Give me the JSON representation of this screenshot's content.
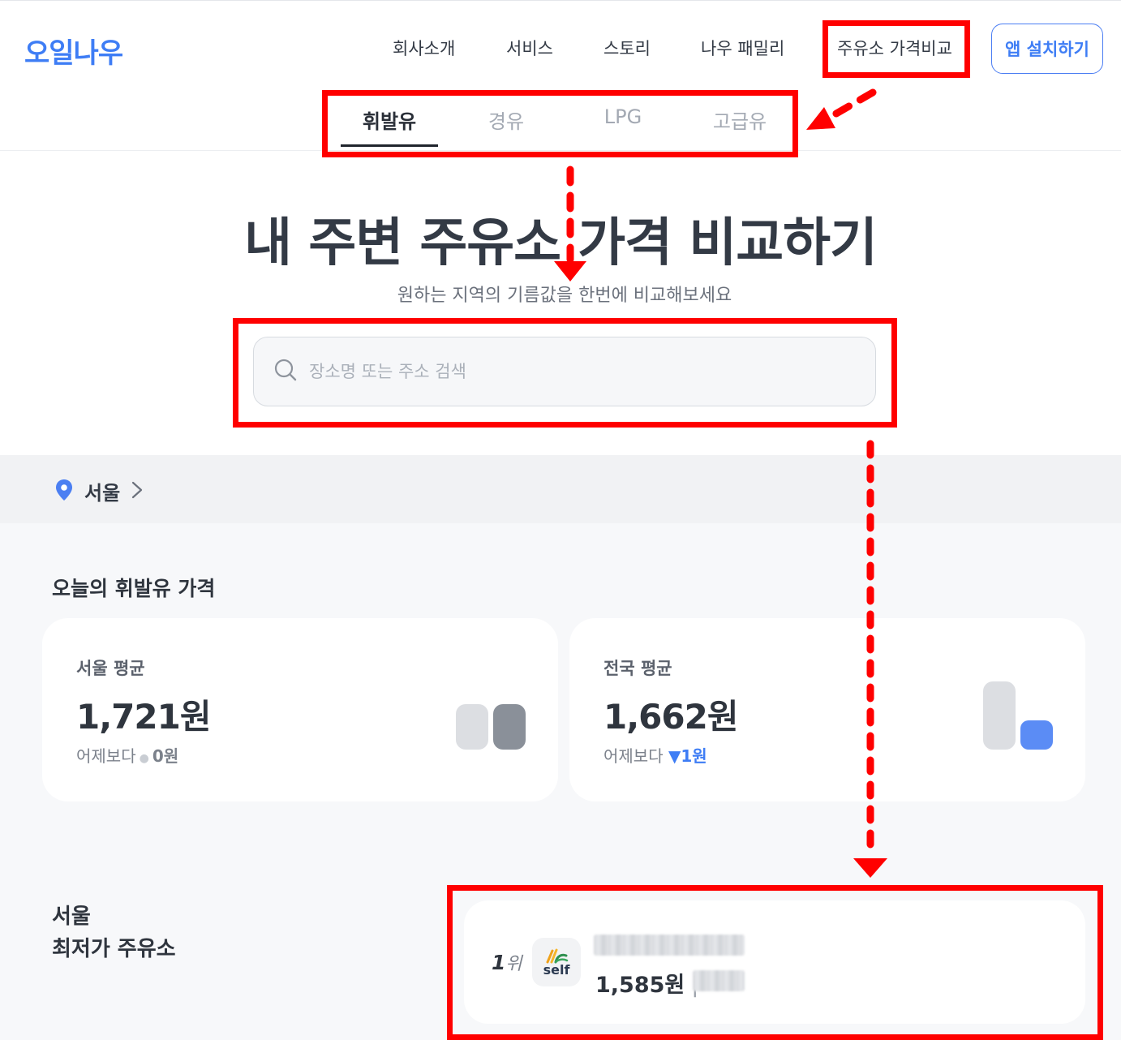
{
  "logo": "오일나우",
  "nav": {
    "items": [
      "회사소개",
      "서비스",
      "스토리",
      "나우 패밀리",
      "주유소 가격비교"
    ],
    "install_button": "앱 설치하기"
  },
  "fuel_tabs": {
    "items": [
      "휘발유",
      "경유",
      "LPG",
      "고급유"
    ],
    "active": "휘발유"
  },
  "hero": {
    "title": "내 주변 주유소 가격 비교하기",
    "subtitle": "원하는 지역의 기름값을 한번에 비교해보세요"
  },
  "search": {
    "placeholder": "장소명 또는 주소 검색",
    "value": ""
  },
  "region": {
    "label": "서울"
  },
  "today": {
    "title": "오늘의 휘발유 가격",
    "cards": [
      {
        "label": "서울 평균",
        "price": "1,721원",
        "delta_prefix": "어제보다",
        "delta_value": "0원"
      },
      {
        "label": "전국 평균",
        "price": "1,662원",
        "delta_prefix": "어제보다",
        "delta_symbol": "▼",
        "delta_value": "1원"
      }
    ]
  },
  "lowest": {
    "title_line1": "서울",
    "title_line2": "최저가 주유소",
    "top_station": {
      "rank_number": "1",
      "rank_suffix": "위",
      "brand_logo_text": "self",
      "price": "1,585원",
      "separator": "|"
    }
  },
  "colors": {
    "accent": "#3e7df5",
    "annotation": "#ff0000",
    "text_dark": "#333a45",
    "text_muted": "#7b818b"
  }
}
